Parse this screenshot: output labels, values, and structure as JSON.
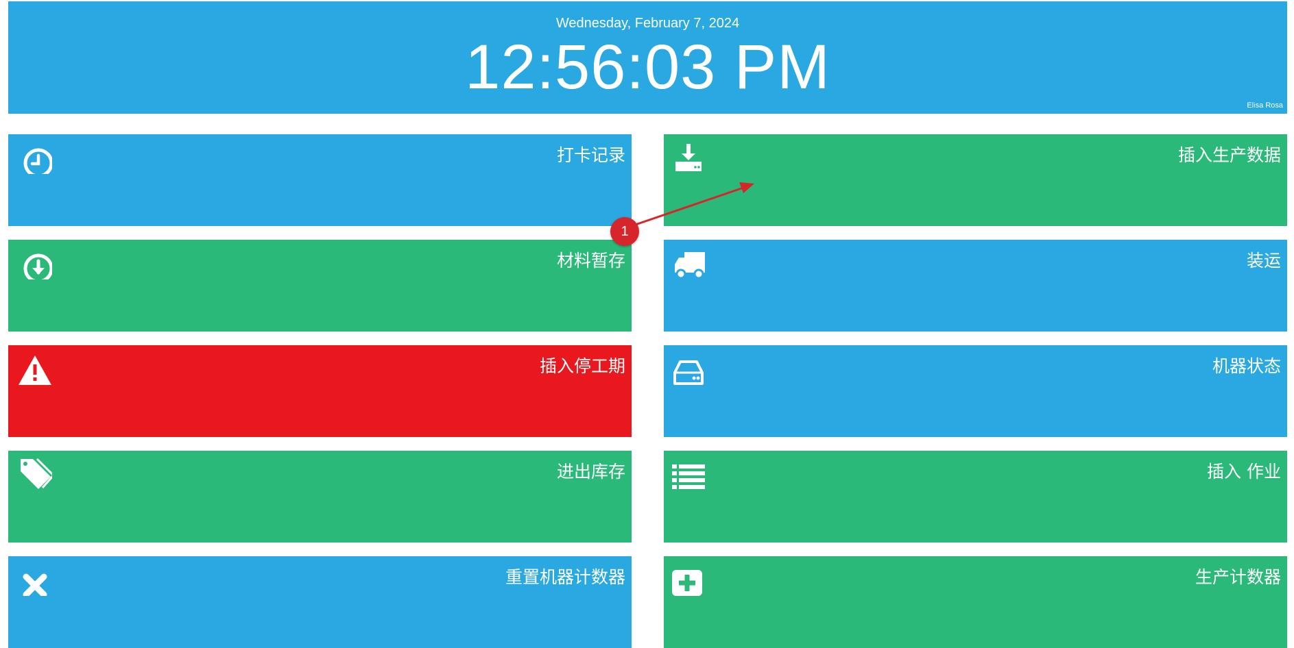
{
  "header": {
    "date": "Wednesday, February 7, 2024",
    "time": "12:56:03 PM",
    "user": "Elisa Rosa",
    "color": "#29a8e2"
  },
  "tiles": {
    "left": [
      {
        "label": "打卡记录",
        "icon": "clock-icon",
        "color": "#29a8e2"
      },
      {
        "label": "材料暂存",
        "icon": "download-circle-icon",
        "color": "#2ab978"
      },
      {
        "label": "插入停工期",
        "icon": "warning-icon",
        "color": "#e8181e"
      },
      {
        "label": "进出库存",
        "icon": "tags-icon",
        "color": "#2ab978"
      },
      {
        "label": "重置机器计数器",
        "icon": "close-icon",
        "color": "#29a8e2"
      }
    ],
    "right": [
      {
        "label": "插入生产数据",
        "icon": "download-tray-icon",
        "color": "#2ab978"
      },
      {
        "label": "装运",
        "icon": "truck-icon",
        "color": "#29a8e2"
      },
      {
        "label": "机器状态",
        "icon": "hdd-icon",
        "color": "#29a8e2"
      },
      {
        "label": "插入 作业",
        "icon": "list-icon",
        "color": "#2ab978"
      },
      {
        "label": "生产计数器",
        "icon": "plus-square-icon",
        "color": "#2ab978"
      }
    ]
  },
  "annotation": {
    "badge": "1",
    "color": "#d7262b"
  }
}
